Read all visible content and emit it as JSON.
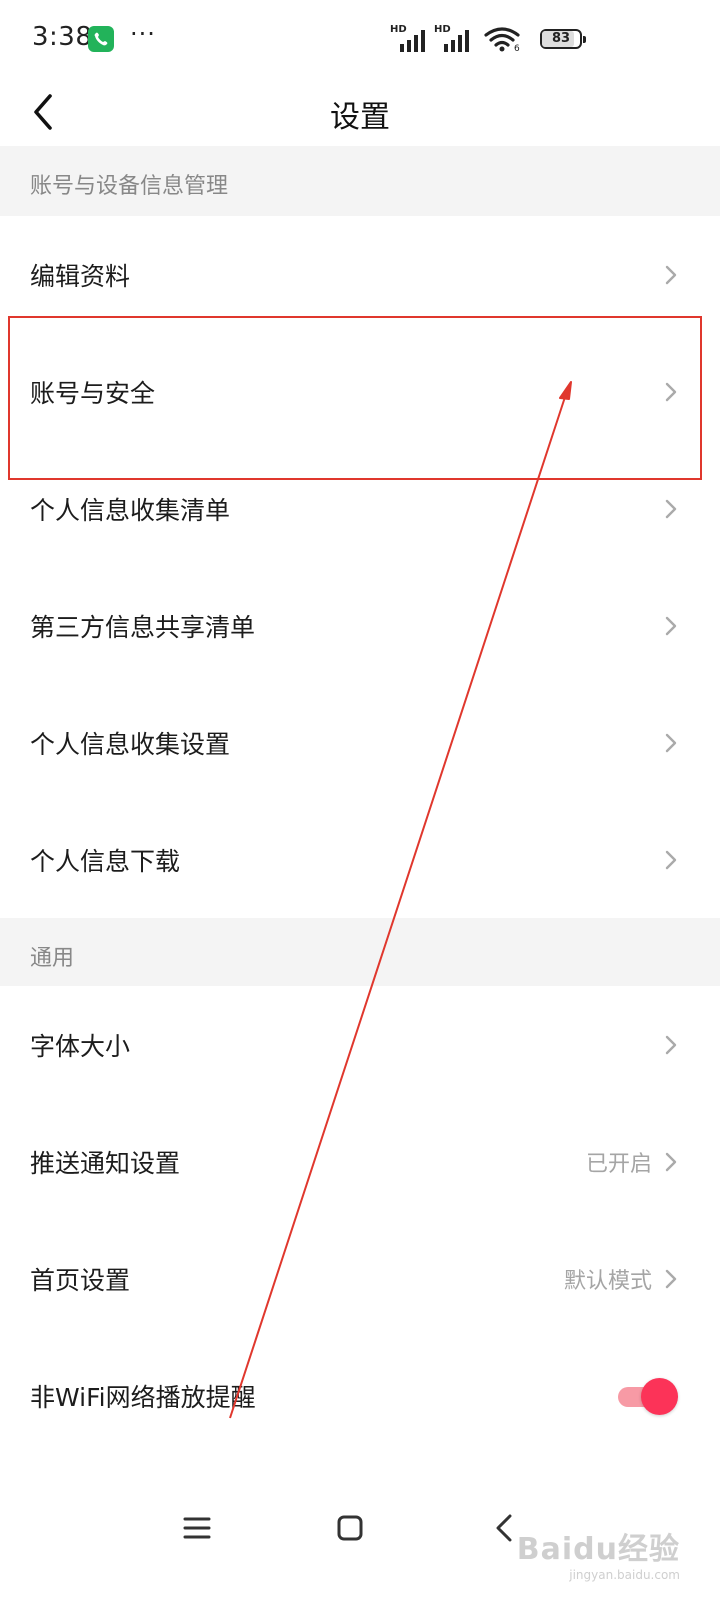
{
  "status_bar": {
    "time": "3:38",
    "dots": "···",
    "battery": "83",
    "battery_level": 0.83,
    "icons": [
      "phone-call-icon",
      "hd-signal-icon",
      "hd-signal-icon",
      "wifi-icon",
      "battery-icon"
    ]
  },
  "header": {
    "title": "设置",
    "back_icon": "back-chevron-icon"
  },
  "sections": [
    {
      "title": "账号与设备信息管理",
      "items": [
        {
          "label": "编辑资料"
        },
        {
          "label": "账号与安全"
        },
        {
          "label": "个人信息收集清单"
        },
        {
          "label": "第三方信息共享清单"
        },
        {
          "label": "个人信息收集设置"
        },
        {
          "label": "个人信息下载"
        }
      ]
    },
    {
      "title": "通用",
      "items": [
        {
          "label": "字体大小"
        },
        {
          "label": "推送通知设置",
          "value": "已开启"
        },
        {
          "label": "首页设置",
          "value": "默认模式"
        },
        {
          "label": "非WiFi网络播放提醒",
          "toggle": true
        }
      ]
    }
  ],
  "colors": {
    "section_bg": "#f4f4f4",
    "toggle_on": "#fc3358",
    "annotation": "#e0372d",
    "call_badge": "#22b35a"
  },
  "system_nav": {
    "icons": [
      "menu-icon",
      "home-square-icon",
      "back-triangle-icon"
    ]
  },
  "watermark": {
    "main": "Baidu经验",
    "sub": "jingyan.baidu.com"
  }
}
